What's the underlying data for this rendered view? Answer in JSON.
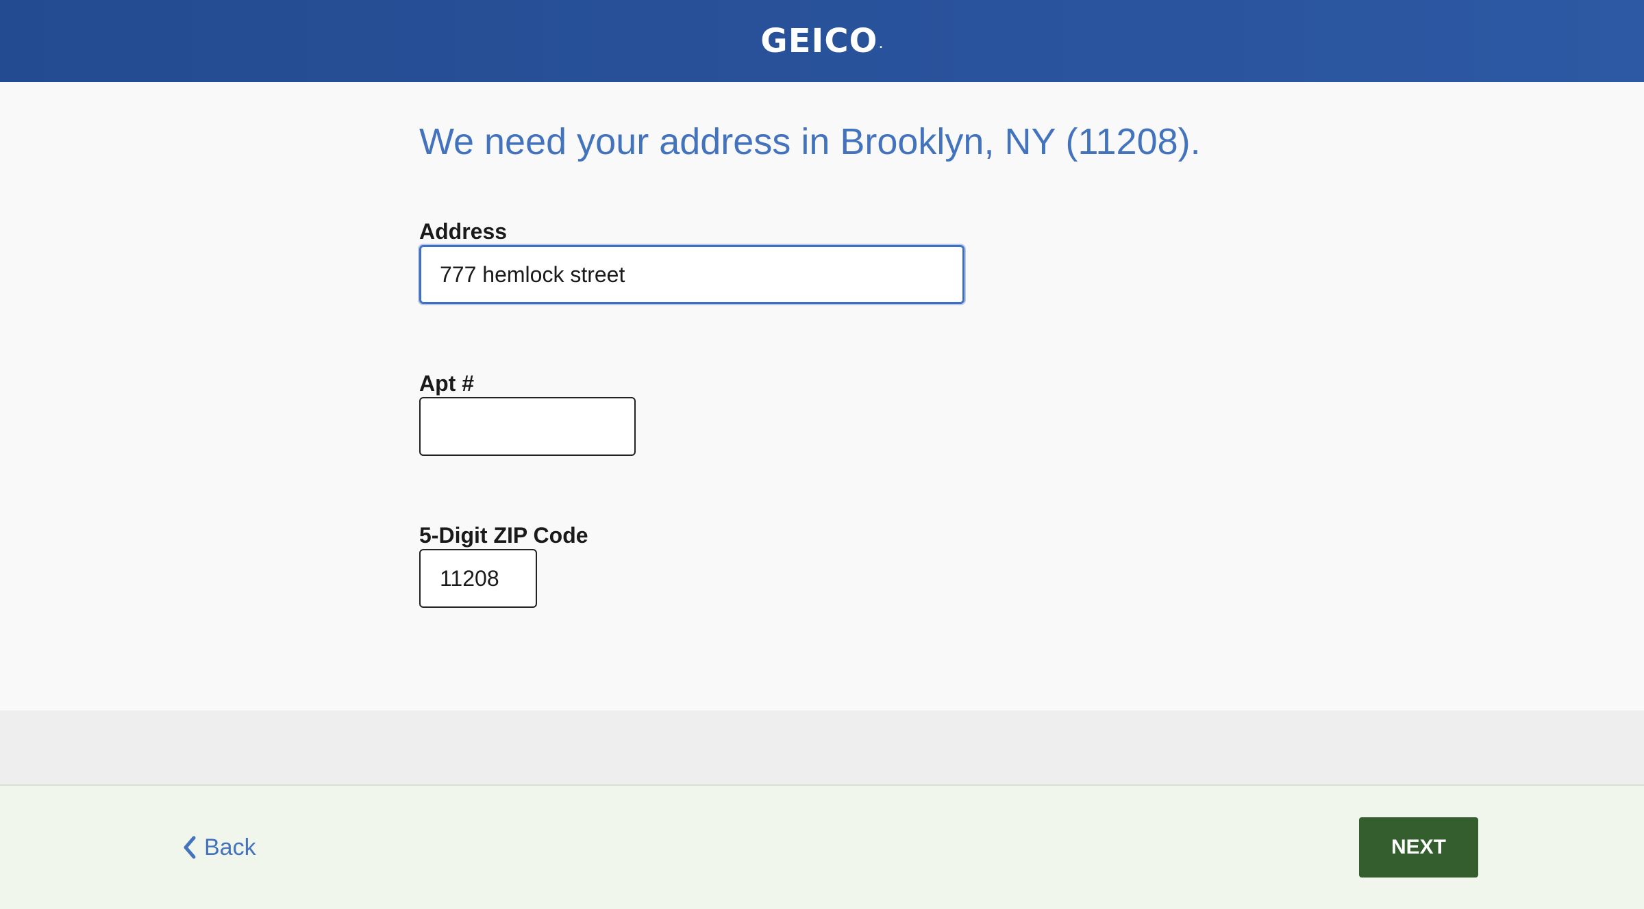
{
  "header": {
    "brand": "GEICO",
    "brand_mark": "."
  },
  "main": {
    "heading": "We need your address in Brooklyn, NY (11208).",
    "fields": {
      "address": {
        "label": "Address",
        "value": "777 hemlock street",
        "placeholder": ""
      },
      "apt": {
        "label": "Apt #",
        "value": "",
        "placeholder": ""
      },
      "zip": {
        "label": "5-Digit ZIP Code",
        "value": "11208",
        "placeholder": ""
      }
    }
  },
  "footer": {
    "back_label": "Back",
    "back_icon": "chevron-left-icon",
    "next_label": "NEXT"
  },
  "colors": {
    "header_bg": "#2a52a0",
    "heading_text": "#4473be",
    "next_button": "#355e2e",
    "footer_bg": "#f0f6ec"
  }
}
